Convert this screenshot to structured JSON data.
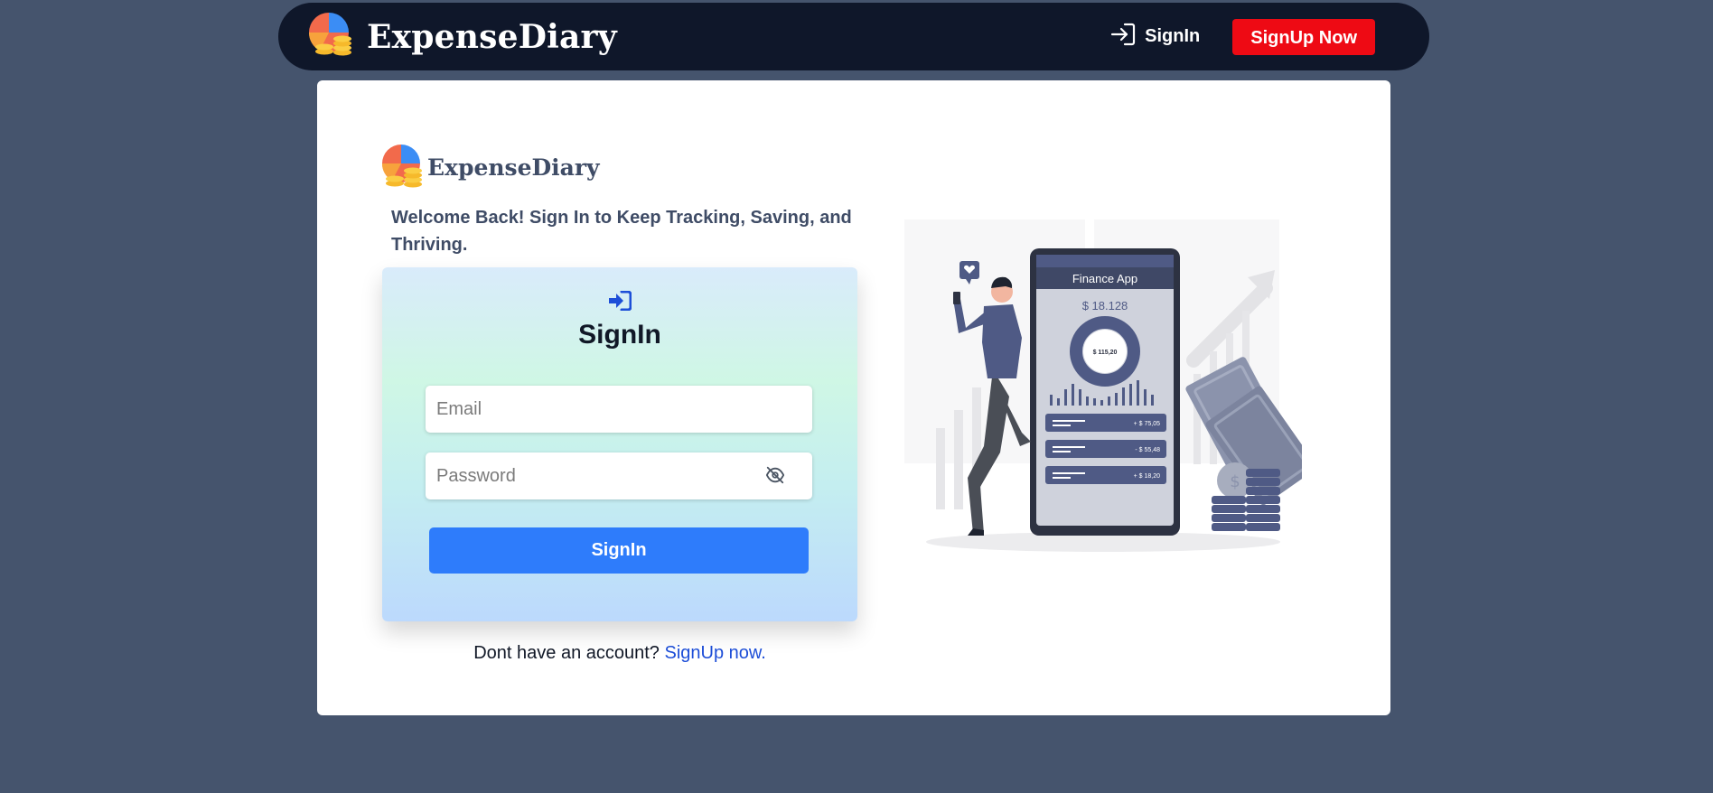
{
  "navbar": {
    "brand_name": "ExpenseDiary",
    "signin_label": "SignIn",
    "signup_label": "SignUp Now"
  },
  "card": {
    "brand_name": "ExpenseDiary",
    "welcome_text": "Welcome Back! Sign In to Keep Tracking, Saving, and Thriving.",
    "form": {
      "title": "SignIn",
      "email_placeholder": "Email",
      "password_placeholder": "Password",
      "submit_label": "SignIn"
    },
    "footer_text": "Dont have an account?",
    "footer_link": "SignUp now."
  },
  "illustration": {
    "app_title": "Finance App",
    "balance": "$ 18.128",
    "donut_value": "$ 115,20",
    "transactions": [
      "+ $ 75,05",
      "- $ 55,48",
      "+ $ 18,20"
    ]
  },
  "colors": {
    "page_bg": "#45546d",
    "navbar_bg": "#0f172a",
    "signup_red": "#ee0a14",
    "primary_blue": "#2e7cfb",
    "link_blue": "#1d4ed8",
    "text_slate": "#3f4c66"
  },
  "icons": {
    "logo": "pie-coins-logo-icon",
    "nav_signin": "login-arrow-icon",
    "form": "sign-in-icon",
    "password_toggle": "eye-slash-icon"
  }
}
